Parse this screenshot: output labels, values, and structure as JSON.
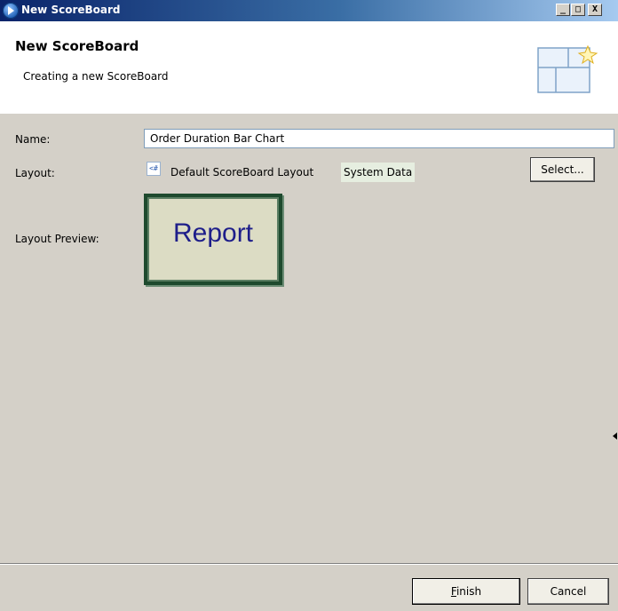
{
  "window": {
    "title": "New ScoreBoard",
    "controls": {
      "minimize": "_",
      "maximize": "□",
      "close": "X"
    }
  },
  "banner": {
    "title": "New ScoreBoard",
    "description": "Creating a new ScoreBoard",
    "icon": "scoreboard-layout-icon"
  },
  "form": {
    "name_label": "Name:",
    "name_value": "Order Duration Bar Chart",
    "layout_label": "Layout:",
    "layout_icon": "layout-file-icon",
    "layout_icon_glyph": "<#",
    "layout_name": "Default ScoreBoard Layout",
    "layout_source": "System Data",
    "select_label": "Select...",
    "preview_label": "Layout Preview:",
    "preview_text": "Report"
  },
  "footer": {
    "finish_label_mnemonic": "F",
    "finish_label_rest": "inish",
    "cancel_label": "Cancel"
  },
  "colors": {
    "titlebar_start": "#0a246a",
    "dialog_bg": "#d4d0c8",
    "preview_frame": "#1e4a2e",
    "preview_text": "#1e1e8a"
  }
}
